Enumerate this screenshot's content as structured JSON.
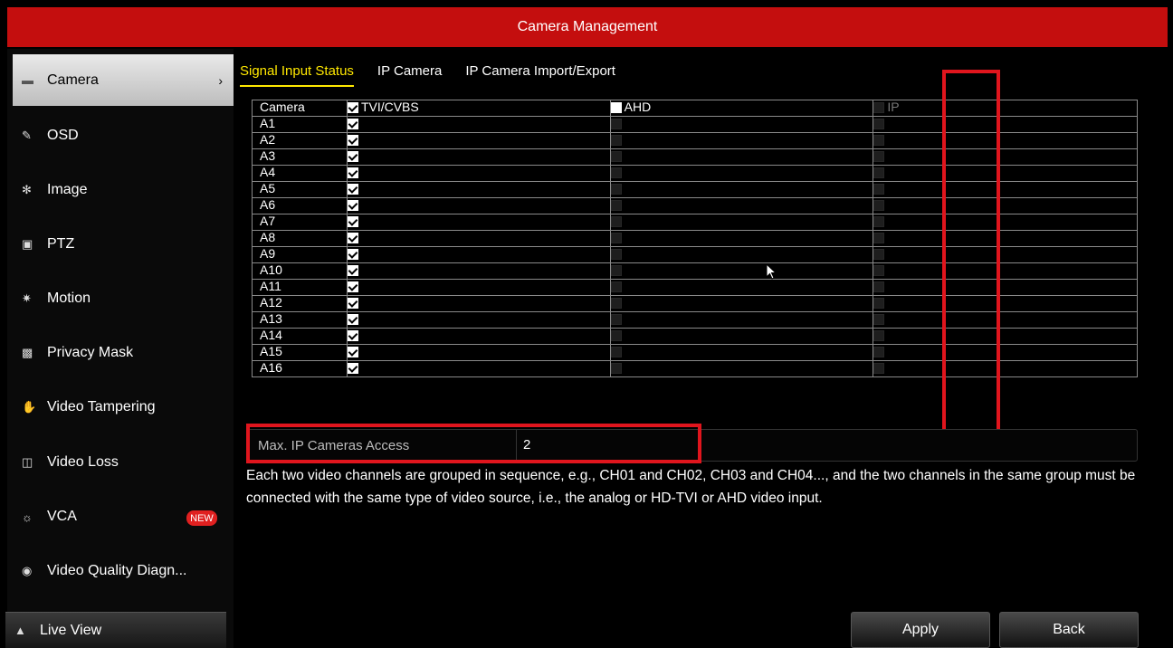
{
  "window": {
    "title": "Camera Management"
  },
  "sidebar": {
    "items": [
      {
        "label": "Camera",
        "icon": "camera-icon",
        "active": true
      },
      {
        "label": "OSD",
        "icon": "osd-brush-icon"
      },
      {
        "label": "Image",
        "icon": "image-palette-icon"
      },
      {
        "label": "PTZ",
        "icon": "ptz-icon"
      },
      {
        "label": "Motion",
        "icon": "motion-runner-icon"
      },
      {
        "label": "Privacy Mask",
        "icon": "privacy-mask-icon"
      },
      {
        "label": "Video Tampering",
        "icon": "video-tampering-icon"
      },
      {
        "label": "Video Loss",
        "icon": "video-loss-icon"
      },
      {
        "label": "VCA",
        "icon": "vca-icon",
        "badge": "NEW"
      },
      {
        "label": "Video Quality Diagn...",
        "icon": "video-quality-icon"
      }
    ],
    "live_view": "Live View"
  },
  "tabs": [
    {
      "label": "Signal Input Status",
      "active": true
    },
    {
      "label": "IP Camera"
    },
    {
      "label": "IP Camera Import/Export"
    }
  ],
  "table": {
    "headers": {
      "camera": "Camera",
      "tvi": "TVI/CVBS",
      "ahd": "AHD",
      "ip": "IP"
    },
    "header_checks": {
      "tvi": true,
      "ahd": false,
      "ip_enabled": false
    },
    "rows": [
      {
        "camera": "A1",
        "tvi": true,
        "ahd": false,
        "ip": false
      },
      {
        "camera": "A2",
        "tvi": true,
        "ahd": false,
        "ip": false
      },
      {
        "camera": "A3",
        "tvi": true,
        "ahd": false,
        "ip": false
      },
      {
        "camera": "A4",
        "tvi": true,
        "ahd": false,
        "ip": false
      },
      {
        "camera": "A5",
        "tvi": true,
        "ahd": false,
        "ip": false
      },
      {
        "camera": "A6",
        "tvi": true,
        "ahd": false,
        "ip": false
      },
      {
        "camera": "A7",
        "tvi": true,
        "ahd": false,
        "ip": false
      },
      {
        "camera": "A8",
        "tvi": true,
        "ahd": false,
        "ip": false
      },
      {
        "camera": "A9",
        "tvi": true,
        "ahd": false,
        "ip": false
      },
      {
        "camera": "A10",
        "tvi": true,
        "ahd": false,
        "ip": false
      },
      {
        "camera": "A11",
        "tvi": true,
        "ahd": false,
        "ip": false
      },
      {
        "camera": "A12",
        "tvi": true,
        "ahd": false,
        "ip": false
      },
      {
        "camera": "A13",
        "tvi": true,
        "ahd": false,
        "ip": false
      },
      {
        "camera": "A14",
        "tvi": true,
        "ahd": false,
        "ip": false
      },
      {
        "camera": "A15",
        "tvi": true,
        "ahd": false,
        "ip": false
      },
      {
        "camera": "A16",
        "tvi": true,
        "ahd": false,
        "ip": false
      }
    ]
  },
  "max_ip": {
    "label": "Max. IP Cameras Access",
    "value": "2"
  },
  "hint": "Each two video channels are grouped in sequence, e.g., CH01 and CH02, CH03 and CH04..., and the two channels in the same group must be connected with the same type of video source, i.e., the analog or HD-TVI or AHD video input.",
  "buttons": {
    "apply": "Apply",
    "back": "Back"
  },
  "colors": {
    "title_bar": "#c40e0e",
    "active_tab": "#ffe800",
    "annotation": "#e0151d",
    "badge": "#e02020"
  }
}
